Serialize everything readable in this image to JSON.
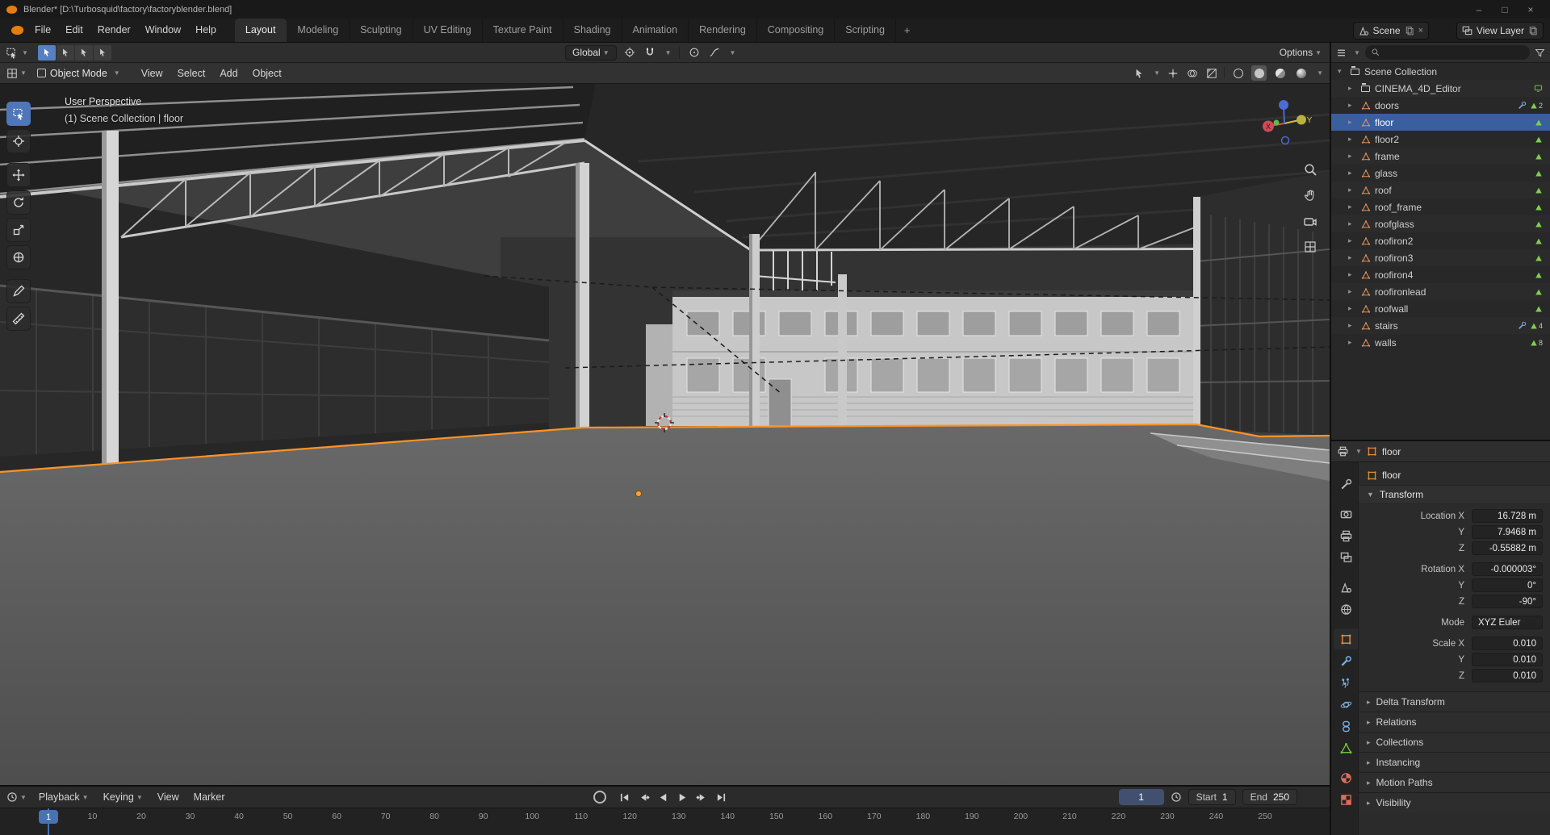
{
  "titlebar": {
    "title": "Blender* [D:\\Turbosquid\\factory\\factoryblender.blend]",
    "minimize": "–",
    "maximize": "□",
    "close": "×"
  },
  "topbar": {
    "menus": [
      "File",
      "Edit",
      "Render",
      "Window",
      "Help"
    ],
    "workspaces": [
      {
        "label": "Layout",
        "active": true
      },
      {
        "label": "Modeling",
        "active": false
      },
      {
        "label": "Sculpting",
        "active": false
      },
      {
        "label": "UV Editing",
        "active": false
      },
      {
        "label": "Texture Paint",
        "active": false
      },
      {
        "label": "Shading",
        "active": false
      },
      {
        "label": "Animation",
        "active": false
      },
      {
        "label": "Rendering",
        "active": false
      },
      {
        "label": "Compositing",
        "active": false
      },
      {
        "label": "Scripting",
        "active": false
      }
    ],
    "add_workspace": "+",
    "scene_name": "Scene",
    "view_layer_name": "View Layer"
  },
  "tool_settings": {
    "orientation": "Global",
    "options_label": "Options",
    "select_mode_icons": [
      "select-mode-set-icon",
      "select-mode-extend-icon",
      "select-mode-subtract-icon",
      "select-mode-intersect-icon"
    ],
    "snap_icons": [
      "snap-target-icon",
      "snap-magnet-icon"
    ],
    "proportional_icons": [
      "proportional-editing-icon",
      "proportional-falloff-icon"
    ]
  },
  "viewport_header": {
    "mode": "Object Mode",
    "menus": [
      "View",
      "Select",
      "Add",
      "Object"
    ],
    "right_icons": [
      "object-type-visibility-icon",
      "gizmo-icon",
      "overlays-icon",
      "toggle-xray-icon"
    ],
    "shading_modes": [
      {
        "name": "wireframe",
        "active": false
      },
      {
        "name": "solid",
        "active": true
      },
      {
        "name": "material-preview",
        "active": false
      },
      {
        "name": "rendered",
        "active": false
      }
    ]
  },
  "viewport": {
    "overlay_line1": "User Perspective",
    "overlay_line2": "(1) Scene Collection | floor",
    "tools": [
      {
        "name": "select-box",
        "active": true
      },
      {
        "name": "cursor",
        "active": false
      },
      {
        "name": "move",
        "active": false
      },
      {
        "name": "rotate",
        "active": false
      },
      {
        "name": "scale",
        "active": false
      },
      {
        "name": "transform",
        "active": false
      },
      {
        "name": "annotate",
        "active": false
      },
      {
        "name": "measure",
        "active": false
      }
    ],
    "nav_icons": [
      "zoom-icon",
      "pan-icon",
      "camera-view-icon",
      "toggle-ortho-icon"
    ],
    "gizmo": {
      "x_label": "X",
      "y_label": "Y"
    }
  },
  "outliner": {
    "root_label": "Scene Collection",
    "items": [
      {
        "label": "CINEMA_4D_Editor",
        "icon": "collection",
        "selected": false,
        "badges": [
          {
            "icon": "screen",
            "count": ""
          }
        ]
      },
      {
        "label": "doors",
        "icon": "mesh",
        "selected": false,
        "badges": [
          {
            "icon": "modifier",
            "count": ""
          },
          {
            "icon": "mesh-data",
            "count": "2"
          }
        ]
      },
      {
        "label": "floor",
        "icon": "mesh",
        "selected": true,
        "badges": [
          {
            "icon": "mesh-data",
            "count": ""
          }
        ]
      },
      {
        "label": "floor2",
        "icon": "mesh",
        "selected": false,
        "badges": [
          {
            "icon": "mesh-data",
            "count": ""
          }
        ]
      },
      {
        "label": "frame",
        "icon": "mesh",
        "selected": false,
        "badges": [
          {
            "icon": "mesh-data",
            "count": ""
          }
        ]
      },
      {
        "label": "glass",
        "icon": "mesh",
        "selected": false,
        "badges": [
          {
            "icon": "mesh-data",
            "count": ""
          }
        ]
      },
      {
        "label": "roof",
        "icon": "mesh",
        "selected": false,
        "badges": [
          {
            "icon": "mesh-data",
            "count": ""
          }
        ]
      },
      {
        "label": "roof_frame",
        "icon": "mesh",
        "selected": false,
        "badges": [
          {
            "icon": "mesh-data",
            "count": ""
          }
        ]
      },
      {
        "label": "roofglass",
        "icon": "mesh",
        "selected": false,
        "badges": [
          {
            "icon": "mesh-data",
            "count": ""
          }
        ]
      },
      {
        "label": "roofiron2",
        "icon": "mesh",
        "selected": false,
        "badges": [
          {
            "icon": "mesh-data",
            "count": ""
          }
        ]
      },
      {
        "label": "roofiron3",
        "icon": "mesh",
        "selected": false,
        "badges": [
          {
            "icon": "mesh-data",
            "count": ""
          }
        ]
      },
      {
        "label": "roofiron4",
        "icon": "mesh",
        "selected": false,
        "badges": [
          {
            "icon": "mesh-data",
            "count": ""
          }
        ]
      },
      {
        "label": "roofironlead",
        "icon": "mesh",
        "selected": false,
        "badges": [
          {
            "icon": "mesh-data",
            "count": ""
          }
        ]
      },
      {
        "label": "roofwall",
        "icon": "mesh",
        "selected": false,
        "badges": [
          {
            "icon": "mesh-data",
            "count": ""
          }
        ]
      },
      {
        "label": "stairs",
        "icon": "mesh",
        "selected": false,
        "badges": [
          {
            "icon": "modifier",
            "count": ""
          },
          {
            "icon": "mesh-data",
            "count": "4"
          }
        ]
      },
      {
        "label": "walls",
        "icon": "mesh",
        "selected": false,
        "badges": [
          {
            "icon": "mesh-data",
            "count": "8"
          }
        ]
      }
    ]
  },
  "properties": {
    "breadcrumb_object": "floor",
    "id_name": "floor",
    "tabs": [
      {
        "name": "tool",
        "active": false
      },
      {
        "name": "render",
        "active": false
      },
      {
        "name": "output",
        "active": false
      },
      {
        "name": "view-layer",
        "active": false
      },
      {
        "name": "scene",
        "active": false
      },
      {
        "name": "world",
        "active": false
      },
      {
        "name": "object",
        "active": true
      },
      {
        "name": "modifiers",
        "active": false
      },
      {
        "name": "particles",
        "active": false
      },
      {
        "name": "physics",
        "active": false
      },
      {
        "name": "constraints",
        "active": false
      },
      {
        "name": "object-data",
        "active": false
      },
      {
        "name": "material",
        "active": false
      },
      {
        "name": "texture",
        "active": false
      }
    ],
    "transform": {
      "label": "Transform",
      "rows": [
        {
          "label": "Location X",
          "value": "16.728 m",
          "group_start": true
        },
        {
          "label": "Y",
          "value": "7.9468 m"
        },
        {
          "label": "Z",
          "value": "-0.55882 m"
        },
        {
          "label": "Rotation X",
          "value": "-0.000003°",
          "group_start": true
        },
        {
          "label": "Y",
          "value": "0°"
        },
        {
          "label": "Z",
          "value": "-90°"
        },
        {
          "label": "Mode",
          "value": "XYZ Euler",
          "group_start": true,
          "align": "left"
        },
        {
          "label": "Scale X",
          "value": "0.010",
          "group_start": true
        },
        {
          "label": "Y",
          "value": "0.010"
        },
        {
          "label": "Z",
          "value": "0.010"
        }
      ]
    },
    "collapsed_panels": [
      "Delta Transform",
      "Relations",
      "Collections",
      "Instancing",
      "Motion Paths",
      "Visibility"
    ]
  },
  "timeline": {
    "menus": [
      "Playback",
      "Keying",
      "View",
      "Marker"
    ],
    "transport": [
      "jump-to-start",
      "jump-to-prev-keyframe",
      "play-reverse",
      "play",
      "jump-to-next-keyframe",
      "jump-to-end"
    ],
    "current_frame": "1",
    "start_label": "Start",
    "start_value": "1",
    "end_label": "End",
    "end_value": "250",
    "frame_ticks": [
      1,
      10,
      20,
      30,
      40,
      50,
      60,
      70,
      80,
      90,
      100,
      110,
      120,
      130,
      140,
      150,
      160,
      170,
      180,
      190,
      200,
      210,
      220,
      230,
      240,
      250
    ]
  },
  "colors": {
    "accent_blue": "#4772b3",
    "accent_orange": "#e87d2c",
    "selection_outline": "#ff9227"
  }
}
